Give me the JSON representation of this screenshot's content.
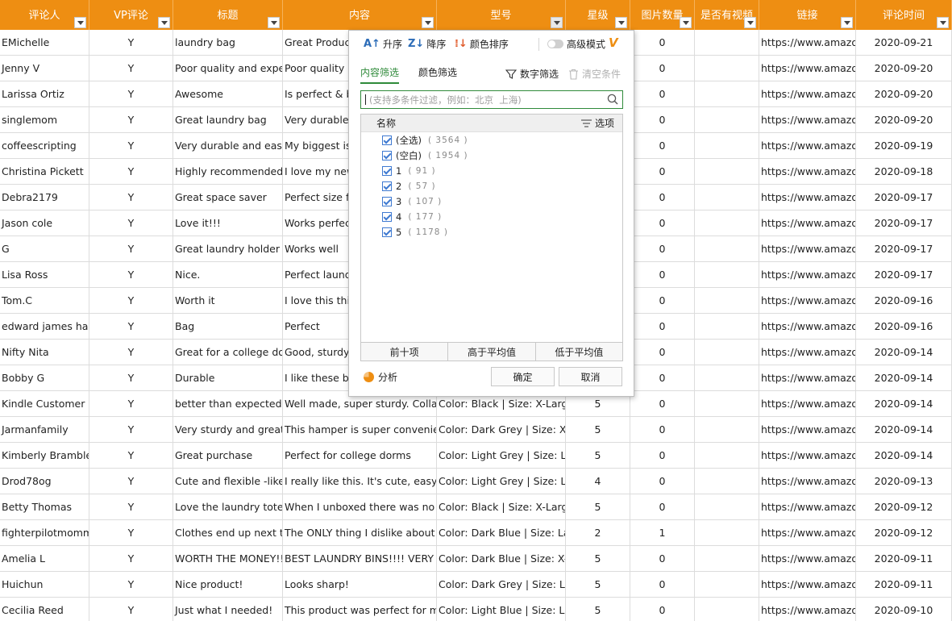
{
  "columns": [
    {
      "label": "评论人",
      "width": 111
    },
    {
      "label": "VP评论",
      "width": 104
    },
    {
      "label": "标题",
      "width": 136
    },
    {
      "label": "内容",
      "width": 191
    },
    {
      "label": "型号",
      "width": 160
    },
    {
      "label": "星级",
      "width": 80
    },
    {
      "label": "图片数量",
      "width": 80
    },
    {
      "label": "是否有视频",
      "width": 80
    },
    {
      "label": "链接",
      "width": 120
    },
    {
      "label": "评论时间",
      "width": 119
    }
  ],
  "rows": [
    [
      "EMichelle",
      "Y",
      "laundry bag",
      "Great Product",
      "",
      "",
      "0",
      "",
      "https://www.amazon.",
      "2020-09-21"
    ],
    [
      "Jenny V",
      "Y",
      "Poor quality and expensive",
      "Poor quality a",
      "",
      "",
      "0",
      "",
      "https://www.amazon.",
      "2020-09-20"
    ],
    [
      "Larissa Ortiz",
      "Y",
      "Awesome",
      "Is perfect & b",
      "",
      "",
      "0",
      "",
      "https://www.amazon.",
      "2020-09-20"
    ],
    [
      "singlemom",
      "Y",
      "Great laundry bag",
      "Very durable.",
      "",
      "",
      "0",
      "",
      "https://www.amazon.",
      "2020-09-20"
    ],
    [
      "coffeescripting",
      "Y",
      "Very durable and easy to",
      "My biggest iss",
      "",
      "",
      "0",
      "",
      "https://www.amazon.",
      "2020-09-19"
    ],
    [
      "Christina Pickett",
      "Y",
      "Highly recommended, w",
      "I love my new",
      "",
      "",
      "0",
      "",
      "https://www.amazon.",
      "2020-09-18"
    ],
    [
      "Debra2179",
      "Y",
      "Great space saver",
      "Perfect size fo",
      "",
      "",
      "0",
      "",
      "https://www.amazon.",
      "2020-09-17"
    ],
    [
      "Jason cole",
      "Y",
      "Love it!!!",
      "Works perfect",
      "",
      "",
      "0",
      "",
      "https://www.amazon.",
      "2020-09-17"
    ],
    [
      "G",
      "Y",
      "Great laundry holder",
      "Works well",
      "",
      "",
      "0",
      "",
      "https://www.amazon.",
      "2020-09-17"
    ],
    [
      "Lisa Ross",
      "Y",
      "Nice.",
      "Perfect laundr",
      "",
      "",
      "0",
      "",
      "https://www.amazon.",
      "2020-09-17"
    ],
    [
      "Tom.C",
      "Y",
      "Worth it",
      "I love this thin",
      "",
      "",
      "0",
      "",
      "https://www.amazon.",
      "2020-09-16"
    ],
    [
      "edward james harris",
      "Y",
      "Bag",
      "Perfect",
      "",
      "",
      "0",
      "",
      "https://www.amazon.",
      "2020-09-16"
    ],
    [
      "Nifty Nita",
      "Y",
      "Great for a college dorm",
      "Good, sturdy a",
      "",
      "",
      "0",
      "",
      "https://www.amazon.",
      "2020-09-14"
    ],
    [
      "Bobby G",
      "Y",
      "Durable",
      "I like these ba",
      "",
      "",
      "0",
      "",
      "https://www.amazon.",
      "2020-09-14"
    ],
    [
      "Kindle Customer",
      "Y",
      "better than expected",
      "Well made, super sturdy. Collapses",
      "Color: Black | Size: X-Large/",
      "5",
      "0",
      "",
      "https://www.amazon.",
      "2020-09-14"
    ],
    [
      "Jarmanfamily",
      "Y",
      "Very sturdy and great size",
      "This hamper is super convenient fo",
      "Color: Dark Grey | Size: X-La",
      "5",
      "0",
      "",
      "https://www.amazon.",
      "2020-09-14"
    ],
    [
      "Kimberly Bramblett",
      "Y",
      "Great purchase",
      "Perfect for college dorms",
      "Color: Light Grey | Size: Larg",
      "5",
      "0",
      "",
      "https://www.amazon.",
      "2020-09-14"
    ],
    [
      "Drod78og",
      "Y",
      "Cute and flexible -like r",
      "I really like this.  It's cute, easy to",
      "Color: Light Grey | Size: Larg",
      "4",
      "0",
      "",
      "https://www.amazon.",
      "2020-09-13"
    ],
    [
      "Betty Thomas",
      "Y",
      "Love the  laundry tote a",
      "When I unboxed there was no coi",
      "Color: Black | Size: X-Large/",
      "5",
      "0",
      "",
      "https://www.amazon.",
      "2020-09-12"
    ],
    [
      "fighterpilotmomma",
      "Y",
      "Clothes end up next to t",
      "The ONLY thing I dislike about thi",
      "Color: Dark Blue | Size: Large",
      "2",
      "1",
      "",
      "https://www.amazon.",
      "2020-09-12"
    ],
    [
      "Amelia L",
      "Y",
      "WORTH THE MONEY!!!",
      "BEST LAUNDRY BINS!!!! VERY SAT",
      "Color: Dark Blue | Size: X-La",
      "5",
      "0",
      "",
      "https://www.amazon.",
      "2020-09-11"
    ],
    [
      "Huichun",
      "Y",
      "Nice product!",
      "Looks sharp!",
      "Color: Dark Grey | Size: Larg",
      "5",
      "0",
      "",
      "https://www.amazon.",
      "2020-09-11"
    ],
    [
      "Cecilia Reed",
      "Y",
      "Just what I needed!",
      "This product was perfect for my do",
      "Color: Light Blue | Size: Larg",
      "5",
      "0",
      "",
      "https://www.amazon.",
      "2020-09-10"
    ]
  ],
  "filter_panel": {
    "sort_asc": "升序",
    "sort_desc": "降序",
    "sort_color": "颜色排序",
    "advanced_mode": "高级模式",
    "tab_content": "内容筛选",
    "tab_color": "颜色筛选",
    "number_filter": "数字筛选",
    "clear_conditions": "清空条件",
    "search_placeholder": "(支持多条件过滤，例如：北京  上海)",
    "list_header": "名称",
    "options_label": "选项",
    "items": [
      {
        "label": "(全选)",
        "count": "( 3564 )"
      },
      {
        "label": "(空白)",
        "count": "( 1954 )"
      },
      {
        "label": "1",
        "count": "( 91 )"
      },
      {
        "label": "2",
        "count": "( 57 )"
      },
      {
        "label": "3",
        "count": "( 107 )"
      },
      {
        "label": "4",
        "count": "( 177 )"
      },
      {
        "label": "5",
        "count": "( 1178 )"
      }
    ],
    "top_ten": "前十项",
    "above_avg": "高于平均值",
    "below_avg": "低于平均值",
    "analysis": "分析",
    "ok": "确定",
    "cancel": "取消"
  },
  "colors": {
    "header_bg": "#ee8e12",
    "accent_green": "#2f8a3a",
    "check_blue": "#3f7ad1"
  }
}
